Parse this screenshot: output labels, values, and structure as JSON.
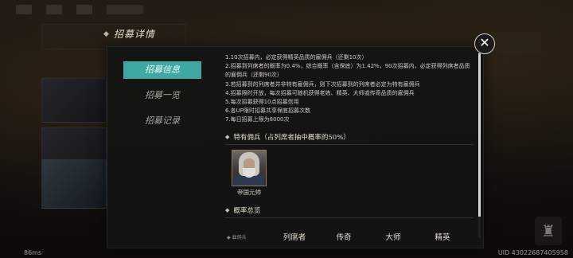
{
  "header": {
    "title": "招募详情"
  },
  "side_tabs": [
    {
      "label": "招募信息",
      "active": true
    },
    {
      "label": "招募一览",
      "active": false
    },
    {
      "label": "招募记录",
      "active": false
    }
  ],
  "rules": [
    "1.10次招募内，必定获得精英品质的雇佣兵（还剩10次）",
    "2.招募到列席者的概率为0.4%，综合概率（含保底）为1.42%，90次招募内，必定获得列席者品质的雇佣兵（还剩90次）",
    "3.若招募到的列席者并非特有雇佣兵，则下次招募到的列席者必定为特有雇佣兵",
    "4.招募限时开放，每次招募可随机获得老练、精英、大师或传奇品质的雇佣兵",
    "5.每次招募获得10点招募信用",
    "6.各UP限时招募共享保底招募次数",
    "7.每日招募上限为8000次"
  ],
  "featured_section": {
    "title": "特有佣兵（占列席者抽中概率的50%）"
  },
  "featured_unit": {
    "name": "帝国元帅"
  },
  "probability_section": {
    "title": "概率总览"
  },
  "probability_table": {
    "hint": "◆ 雇佣兵",
    "columns": [
      "列席者",
      "传奇",
      "大师",
      "精英"
    ]
  },
  "close_icon": "✕",
  "status": {
    "ping": "86ms",
    "uid": "UID 43022687405958"
  },
  "colors": {
    "accent_tab": "#3fa8a3",
    "modal_bg": "#141414"
  },
  "icons": [
    "close-icon",
    "chevron-left-icon",
    "diamond-bullet-icon",
    "emblem-icon"
  ]
}
